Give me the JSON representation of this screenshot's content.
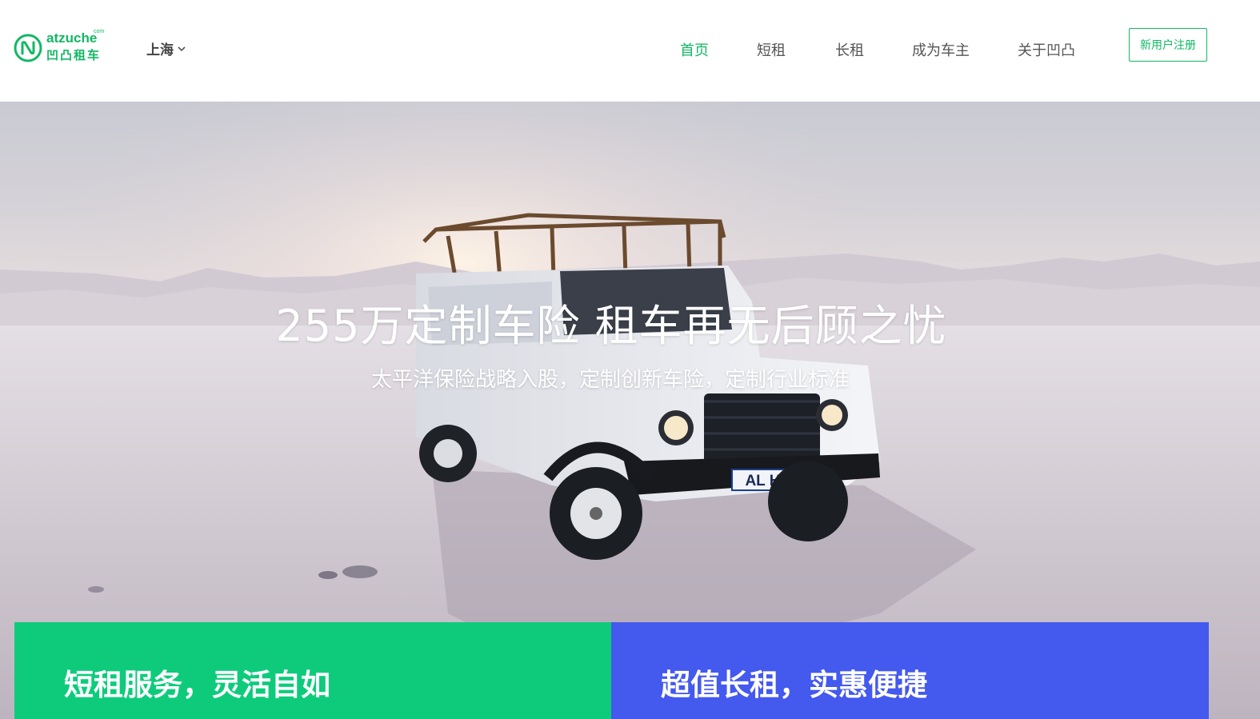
{
  "header": {
    "logo": {
      "en": "atzuche",
      "com": "com",
      "cn": "凹凸租车"
    },
    "city": "上海",
    "nav": [
      {
        "label": "首页",
        "active": true
      },
      {
        "label": "短租",
        "active": false
      },
      {
        "label": "长租",
        "active": false
      },
      {
        "label": "成为车主",
        "active": false
      },
      {
        "label": "关于凹凸",
        "active": false
      }
    ],
    "register_label": "新用户注册"
  },
  "hero": {
    "title": "255万定制车险 租车再无后顾之忧",
    "subtitle": "太平洋保险战略入股，定制创新车险，定制行业标准",
    "plate": "AL H12"
  },
  "cards": {
    "short": {
      "title": "短租服务，灵活自如",
      "color": "#0ecb7c"
    },
    "long": {
      "title": "超值长租，实惠便捷",
      "color": "#4459ee"
    }
  },
  "colors": {
    "brand": "#12b864",
    "nav_text": "#555555"
  }
}
